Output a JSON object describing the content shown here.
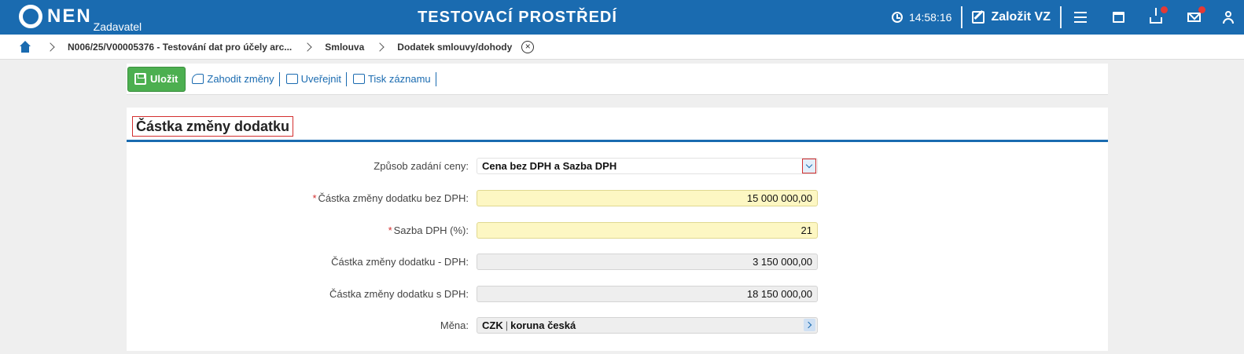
{
  "header": {
    "logo_text": "NEN",
    "logo_sub": "Zadavatel",
    "env_title": "TESTOVACÍ PROSTŘEDÍ",
    "clock": "14:58:16",
    "create_label": "Založit VZ",
    "icons": [
      "clock-icon",
      "edit-icon",
      "menu-icon",
      "calendar-icon",
      "download-icon",
      "mail-icon",
      "user-icon"
    ],
    "badge_color": "#e53935",
    "accent": "#1a6bb0"
  },
  "breadcrumb": {
    "items": [
      "N006/25/V00005376 - Testování dat pro účely arc...",
      "Smlouva",
      "Dodatek smlouvy/dohody"
    ]
  },
  "toolbar": {
    "save_label": "Uložit",
    "discard_label": "Zahodit změny",
    "publish_label": "Uveřejnit",
    "print_label": "Tisk záznamu"
  },
  "section": {
    "title": "Částka změny dodatku"
  },
  "form": {
    "price_mode_label": "Způsob zadání ceny:",
    "price_mode_value": "Cena bez DPH a Sazba DPH",
    "amount_excl_label": "Částka změny dodatku bez DPH:",
    "amount_excl_value": "15 000 000,00",
    "vat_rate_label": "Sazba DPH (%):",
    "vat_rate_value": "21",
    "vat_amount_label": "Částka změny dodatku - DPH:",
    "vat_amount_value": "3 150 000,00",
    "amount_incl_label": "Částka změny dodatku s DPH:",
    "amount_incl_value": "18 150 000,00",
    "currency_label": "Měna:",
    "currency_code": "CZK",
    "currency_name": "koruna česká",
    "required_mark": "*"
  }
}
